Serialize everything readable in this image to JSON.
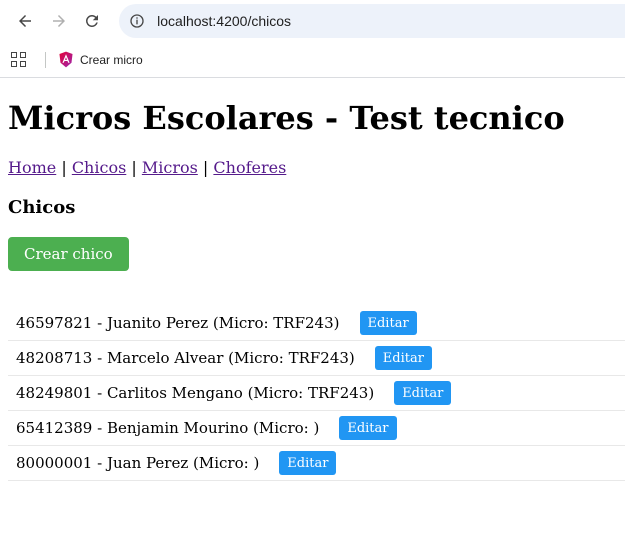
{
  "browser": {
    "url": "localhost:4200/chicos",
    "bookmark_label": "Crear micro"
  },
  "page": {
    "title": "Micros Escolares - Test tecnico",
    "nav": [
      "Home",
      "Chicos",
      "Micros",
      "Choferes"
    ],
    "nav_separator": "|",
    "section_title": "Chicos",
    "create_button": "Crear chico",
    "edit_label": "Editar",
    "items": [
      {
        "text": "46597821 - Juanito Perez (Micro: TRF243)"
      },
      {
        "text": "48208713 - Marcelo Alvear (Micro: TRF243)"
      },
      {
        "text": "48249801 - Carlitos Mengano (Micro: TRF243)"
      },
      {
        "text": "65412389 - Benjamin Mourino (Micro: )"
      },
      {
        "text": "80000001 - Juan Perez (Micro: )"
      }
    ]
  },
  "colors": {
    "create_button": "#4caf50",
    "edit_button": "#2196f3",
    "link_visited": "#551a8b"
  },
  "icons": [
    "back-arrow-icon",
    "forward-arrow-icon",
    "reload-icon",
    "site-info-icon",
    "apps-grid-icon",
    "angular-logo-icon"
  ]
}
